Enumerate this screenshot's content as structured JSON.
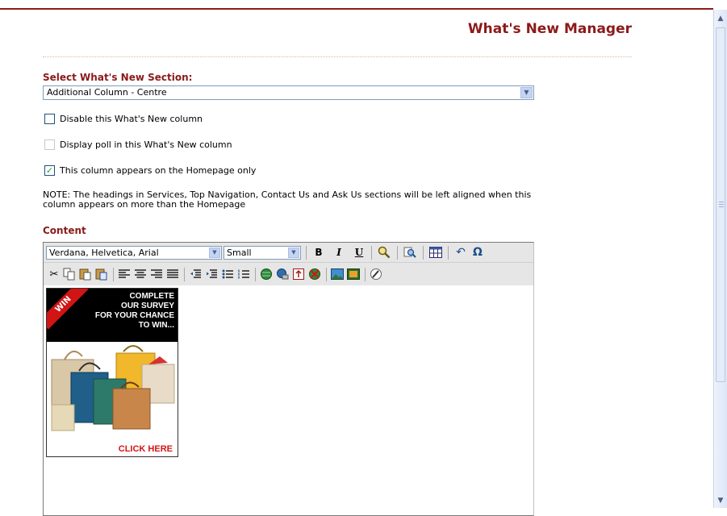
{
  "header": {
    "title": "What's New Manager"
  },
  "section_select": {
    "label": "Select What's New Section:",
    "selected_value": "Additional Column - Centre"
  },
  "options": [
    {
      "label": "Disable this What's New column",
      "checked": false,
      "enabled": true
    },
    {
      "label": "Display poll in this What's New column",
      "checked": false,
      "enabled": false
    },
    {
      "label": "This column appears on the Homepage only",
      "checked": true,
      "enabled": true
    }
  ],
  "note": "NOTE: The headings in Services, Top Navigation, Contact Us and Ask Us sections will be left aligned when this column appears on more than the Homepage",
  "content": {
    "label": "Content",
    "editor": {
      "font_value": "Verdana, Helvetica, Arial",
      "size_value": "Small",
      "toolbar1_buttons": [
        "bold-icon",
        "italic-icon",
        "underline-icon",
        "find-icon",
        "replace-icon",
        "table-icon",
        "undo-icon",
        "special-char-icon"
      ],
      "toolbar2_buttons": [
        "cut-icon",
        "copy-icon",
        "paste-icon",
        "paste-word-icon",
        "align-left-icon",
        "align-center-icon",
        "align-right-icon",
        "justify-icon",
        "outdent-icon",
        "indent-icon",
        "bullet-list-icon",
        "numbered-list-icon",
        "link-icon",
        "anchor-icon",
        "upload-icon",
        "unlink-icon",
        "image-icon",
        "gallery-icon",
        "edit-source-icon"
      ],
      "banner": {
        "corner": "WIN",
        "line1": "COMPLETE",
        "line2": "OUR SURVEY",
        "line3": "FOR YOUR CHANCE",
        "line4": "TO WIN...",
        "cta": "CLICK HERE"
      }
    }
  },
  "colors": {
    "accent": "#8b1a1a",
    "checkmark": "#21a121",
    "banner_red": "#d11515"
  }
}
